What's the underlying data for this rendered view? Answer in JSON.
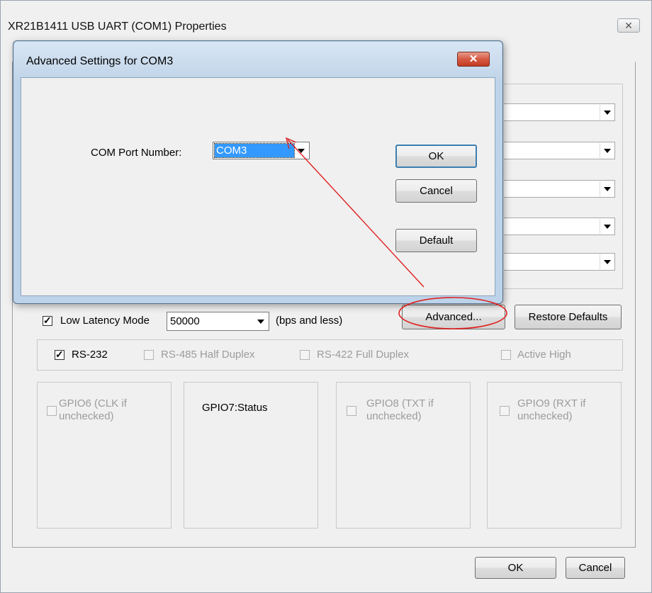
{
  "outer_window": {
    "title": "XR21B1411 USB UART (COM1) Properties",
    "close_label": "✕"
  },
  "advanced_dialog": {
    "title": "Advanced Settings for COM3",
    "close_label": "✕",
    "port_label": "COM Port Number:",
    "port_value": "COM3",
    "ok_label": "OK",
    "cancel_label": "Cancel",
    "default_label": "Default"
  },
  "latency": {
    "checked": true,
    "label": "Low Latency Mode",
    "value": "50000",
    "suffix": "(bps and less)"
  },
  "buttons": {
    "advanced_label": "Advanced...",
    "restore_label": "Restore Defaults",
    "ok_label": "OK",
    "cancel_label": "Cancel"
  },
  "modes": {
    "rs232": {
      "label": "RS-232",
      "checked": true,
      "enabled": true
    },
    "rs485": {
      "label": "RS-485 Half Duplex",
      "checked": false,
      "enabled": false
    },
    "rs422": {
      "label": "RS-422 Full Duplex",
      "checked": false,
      "enabled": false
    },
    "active_high": {
      "label": "Active High",
      "checked": false,
      "enabled": false
    }
  },
  "gpio": {
    "gpio6": {
      "label_line1": "GPIO6 (CLK if",
      "label_line2": "unchecked)",
      "enabled": false
    },
    "gpio7": {
      "label": "GPIO7:Status"
    },
    "gpio8": {
      "label_line1": "GPIO8 (TXT if",
      "label_line2": "unchecked)",
      "enabled": false
    },
    "gpio9": {
      "label_line1": "GPIO9 (RXT if",
      "label_line2": "unchecked)",
      "enabled": false
    }
  },
  "annotation_color": "#e02020",
  "accent_color": "#3399ff"
}
